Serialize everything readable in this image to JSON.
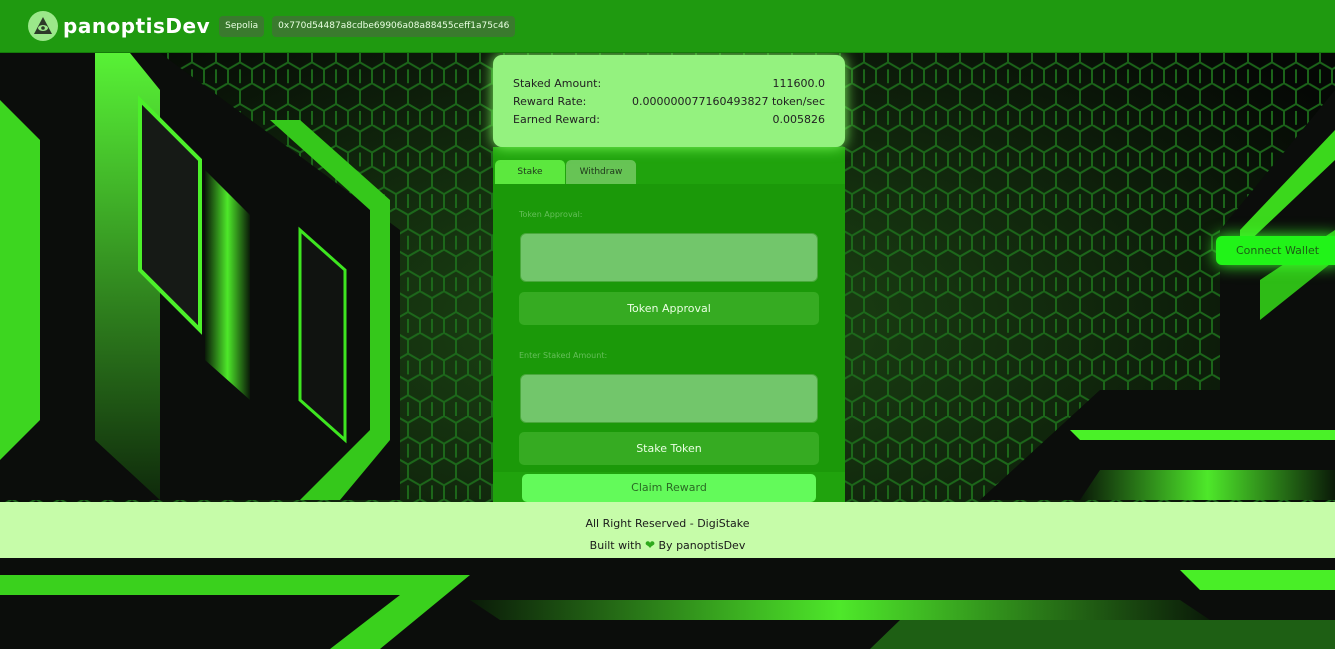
{
  "header": {
    "brand": "panoptisDev",
    "network": "Sepolia",
    "address": "0x770d54487a8cdbe69906a08a88455ceff1a75c46"
  },
  "stats": {
    "staked_label": "Staked Amount:",
    "staked_value": "111600.0",
    "rate_label": "Reward Rate:",
    "rate_value": "0.000000077160493827 token/sec",
    "earned_label": "Earned Reward:",
    "earned_value": "0.005826"
  },
  "tabs": [
    {
      "label": "Stake",
      "active": true
    },
    {
      "label": "Withdraw",
      "active": false
    }
  ],
  "approval": {
    "label": "Token Approval:",
    "value": "",
    "button": "Token Approval"
  },
  "stake": {
    "label": "Enter Staked Amount:",
    "value": "",
    "button": "Stake Token"
  },
  "claim_button": "Claim Reward",
  "connect_button": "Connect Wallet",
  "footer": {
    "line1": "All Right Reserved - DigiStake",
    "line2_pre": "Built with",
    "line2_post": "By panoptisDev"
  },
  "colors": {
    "header_bg": "#1f9a10",
    "accent_green": "#21f318",
    "panel_green": "#1b9909",
    "footer_bg": "#c6fca9"
  }
}
